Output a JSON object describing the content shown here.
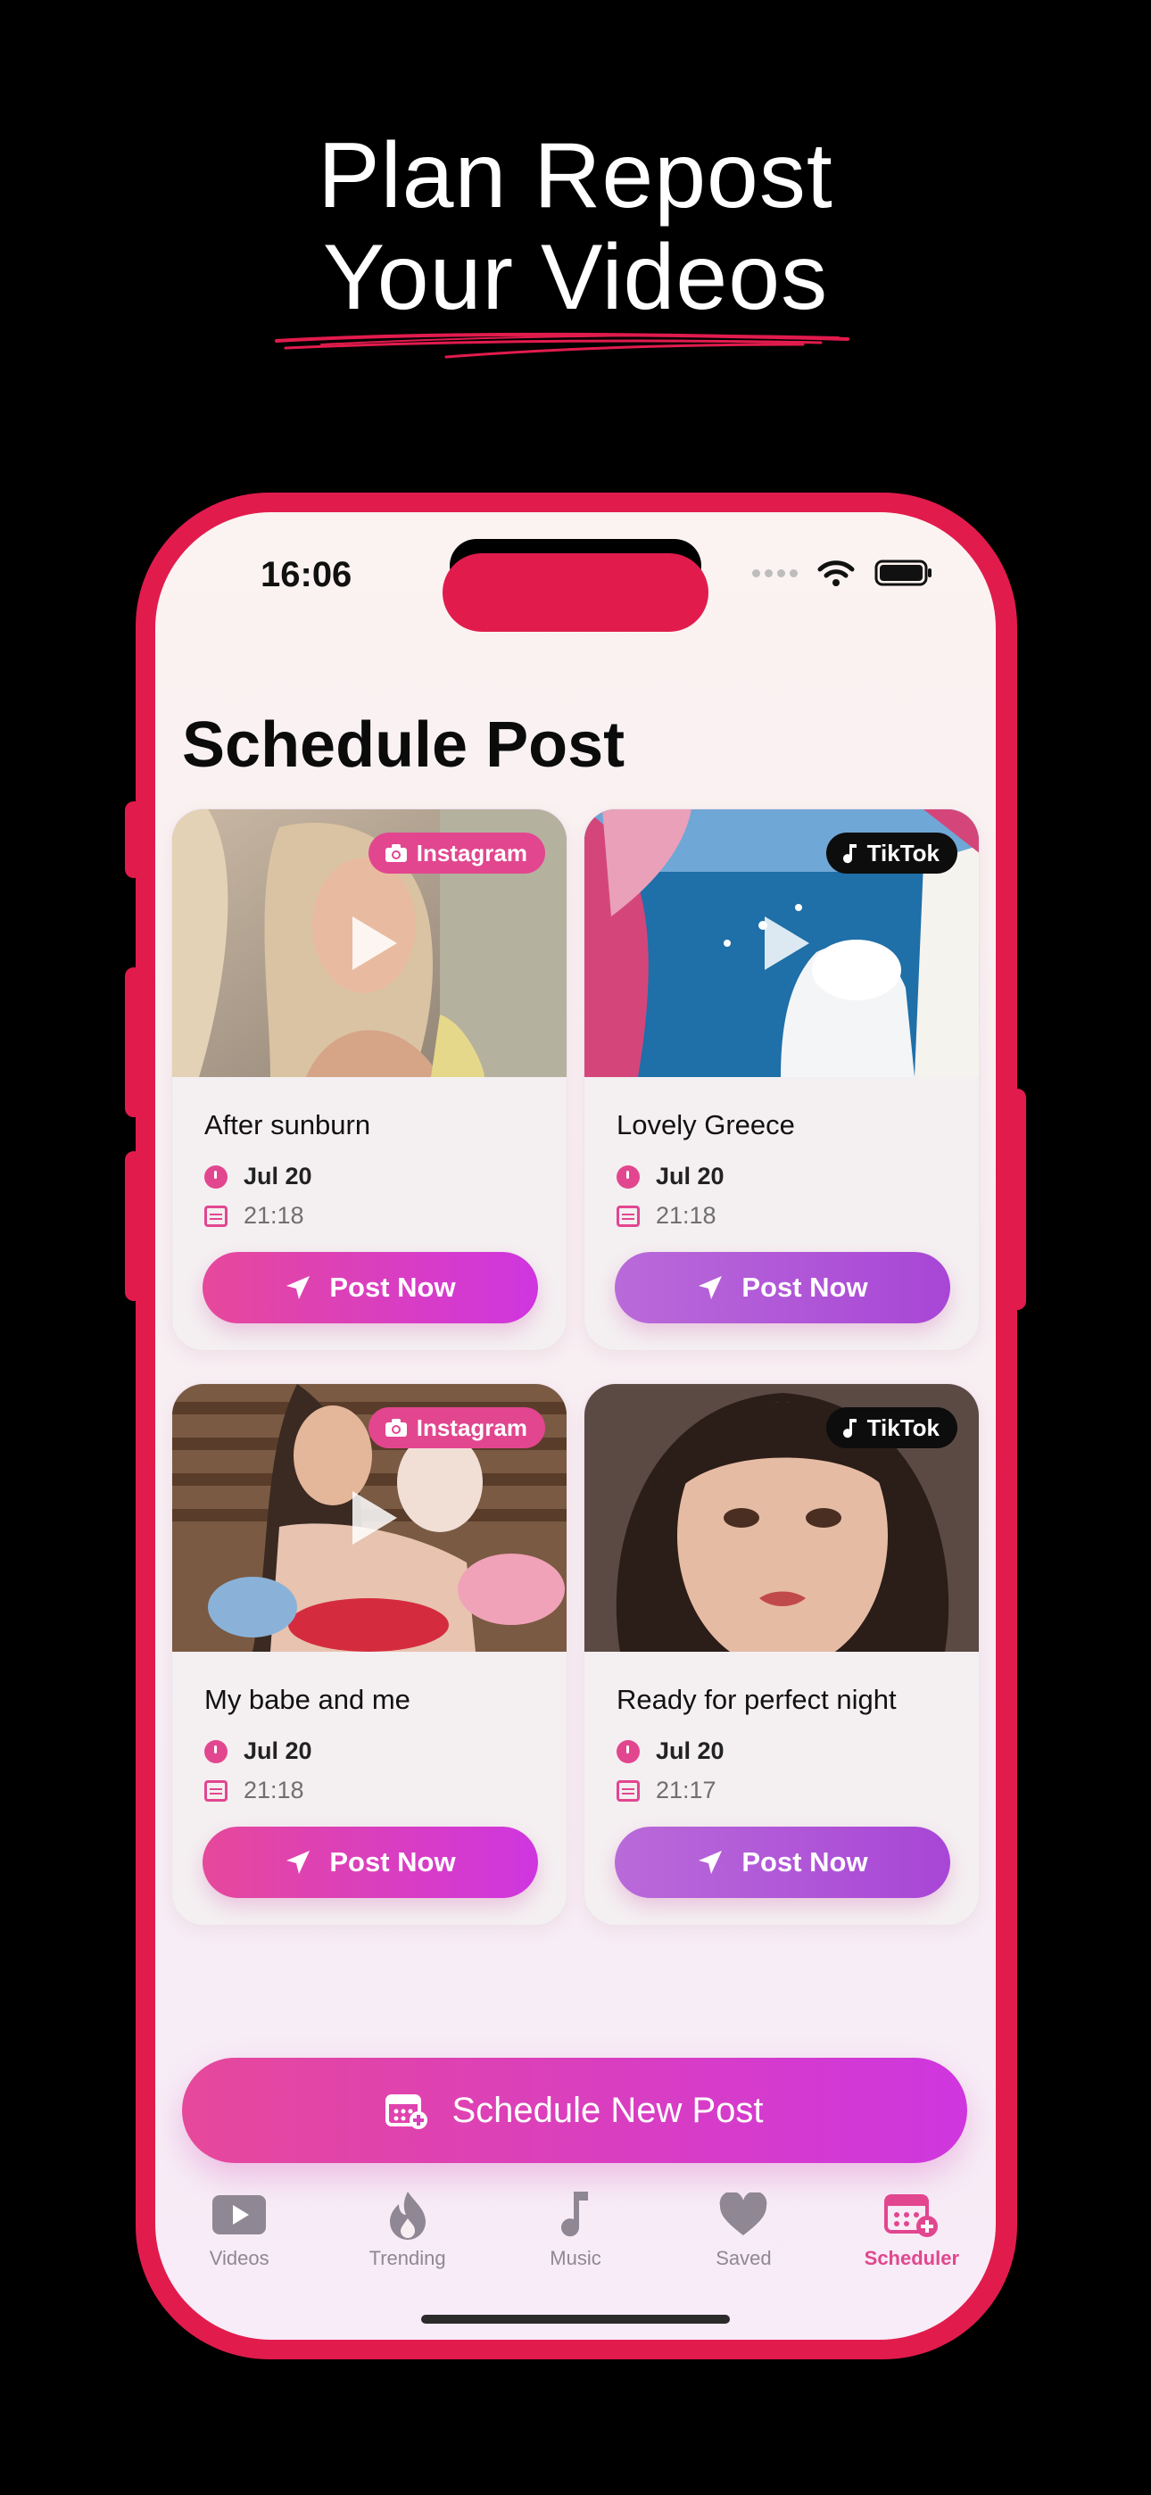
{
  "headline": {
    "line1": "Plan Repost",
    "line2": "Your Videos"
  },
  "status_bar": {
    "time": "16:06"
  },
  "screen": {
    "title": "Schedule Post"
  },
  "cards": [
    {
      "title": "After sunburn",
      "platform": "Instagram",
      "date": "Jul 20",
      "time": "21:18",
      "button": "Post Now"
    },
    {
      "title": "Lovely Greece",
      "platform": "TikTok",
      "date": "Jul 20",
      "time": "21:18",
      "button": "Post Now"
    },
    {
      "title": "My babe and me",
      "platform": "Instagram",
      "date": "Jul 20",
      "time": "21:18",
      "button": "Post Now"
    },
    {
      "title": "Ready for perfect night",
      "platform": "TikTok",
      "date": "Jul 20",
      "time": "21:17",
      "button": "Post Now"
    }
  ],
  "schedule_button": {
    "label": "Schedule New Post"
  },
  "tabs": [
    {
      "label": "Videos",
      "icon": "play-icon"
    },
    {
      "label": "Trending",
      "icon": "flame-icon"
    },
    {
      "label": "Music",
      "icon": "music-note-icon"
    },
    {
      "label": "Saved",
      "icon": "heart-icon"
    },
    {
      "label": "Scheduler",
      "icon": "calendar-plus-icon",
      "active": true
    }
  ],
  "colors": {
    "accent": "#e2468f",
    "frame": "#e21b4d",
    "purple": "#b05ad8",
    "background": "#000000"
  }
}
